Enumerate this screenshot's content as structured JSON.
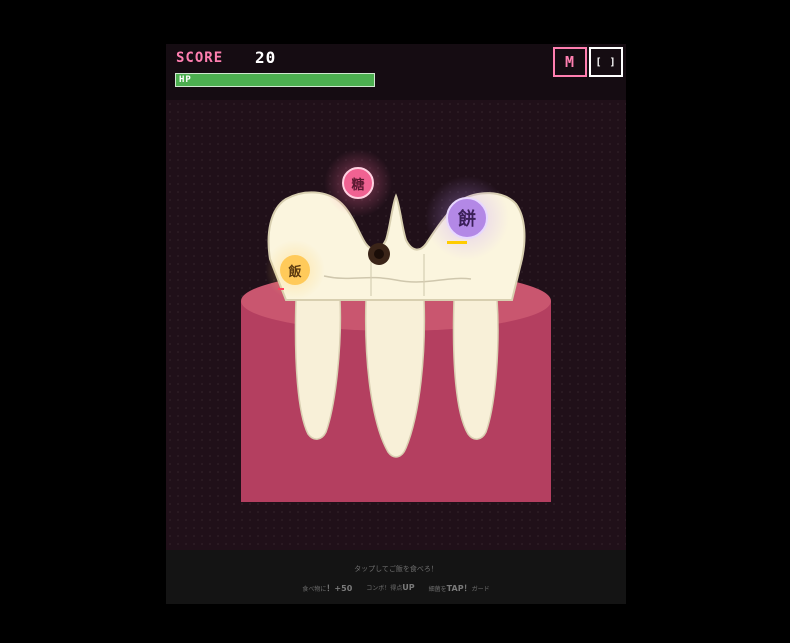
{
  "hud": {
    "score_label": "SCORE",
    "score_value": "20",
    "hp_label": "HP",
    "hp_fraction": 1.0,
    "menu_button": "M",
    "fullscreen_button": "[ ]"
  },
  "foods": [
    {
      "id": "sugar",
      "glyph": "糖",
      "color": "#f06292"
    },
    {
      "id": "mochi",
      "glyph": "餅",
      "color": "#b388e6"
    },
    {
      "id": "rice",
      "glyph": "飯",
      "color": "#ffca5a"
    }
  ],
  "footer": {
    "hint": "タップしてご飯を食べろ！",
    "rules": [
      {
        "small_pre": "食べ物に",
        "big": "！+50",
        "small_post": ""
      },
      {
        "small_pre": "コンボ！",
        "big": "UP",
        "small_post": "得点"
      },
      {
        "small_pre": "細菌を",
        "big": "TAP！",
        "small_post": "ガード"
      }
    ]
  },
  "colors": {
    "background": "#000000",
    "playfield": "#201019",
    "gum": "#b43f60",
    "tooth": "#fbf5de",
    "hp_fill": "#4caf50",
    "accent": "#ff7fb0"
  }
}
